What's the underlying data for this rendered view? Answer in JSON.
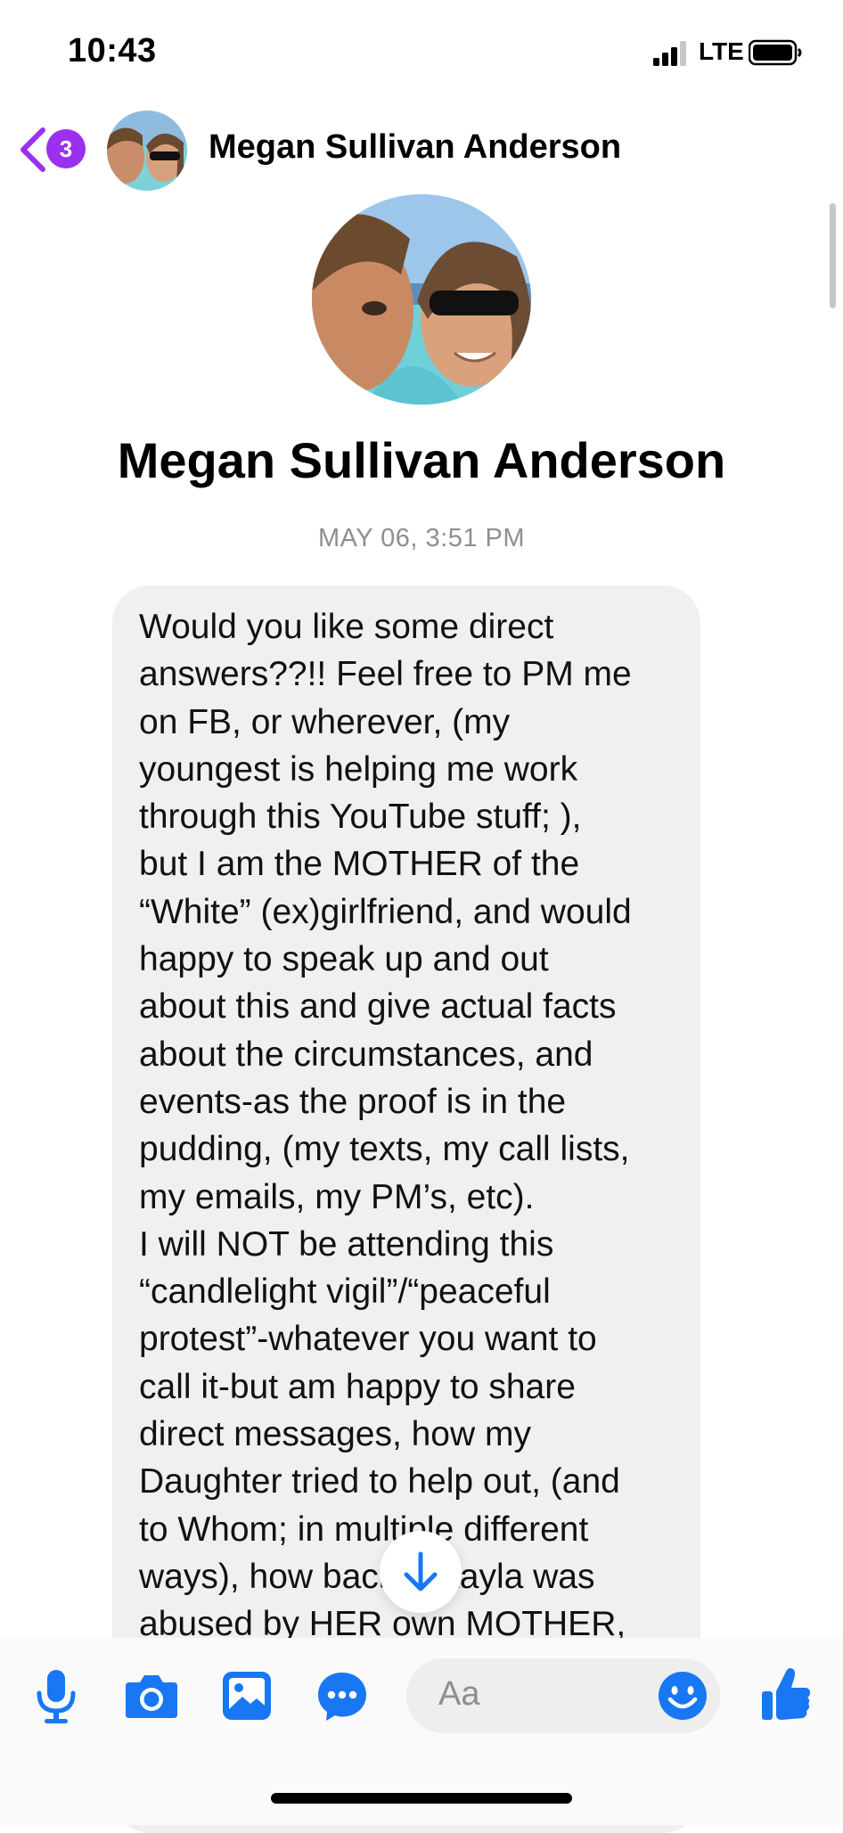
{
  "status_bar": {
    "time": "10:43",
    "network": "LTE",
    "icons": [
      "signal-icon",
      "battery-icon"
    ]
  },
  "header": {
    "back_badge_count": "3",
    "contact_name": "Megan Sullivan Anderson",
    "icons": [
      "back-chevron-icon",
      "avatar"
    ]
  },
  "profile": {
    "name": "Megan Sullivan Anderson",
    "timestamp": "MAY 06, 3:51 PM"
  },
  "message": {
    "lines": [
      "Would you like some direct",
      "answers??!! Feel free to PM me",
      "on FB, or wherever, (my",
      "youngest is helping me work",
      "through this YouTube stuff; ),",
      "but I am the MOTHER of the",
      "“White” (ex)girlfriend, and would",
      "happy to speak up and out",
      "about this and give actual facts",
      "about the circumstances, and",
      "events-as the proof is in the",
      "pudding, (my texts, my call lists,",
      "my emails, my PM’s, etc).",
      "I will NOT be attending this",
      "“candlelight vigil”/“peaceful",
      "protest”-whatever you want to",
      "call it-but am happy to share",
      "direct messages, how my",
      "Daughter tried to help out, (and",
      "to Whom; in multiple different",
      "ways), how back Mikayla was",
      "abused by HER own MOTHER,"
    ]
  },
  "composer": {
    "placeholder": "Aa",
    "icons": [
      "microphone-icon",
      "camera-icon",
      "image-icon",
      "chat-bubble-icon",
      "emoji-icon",
      "thumbs-up-icon"
    ]
  },
  "colors": {
    "accent_purple": "#9b30f0",
    "messenger_blue": "#1877f2",
    "bubble_gray": "#f0f0f0",
    "timestamp_gray": "#8e8e93"
  }
}
